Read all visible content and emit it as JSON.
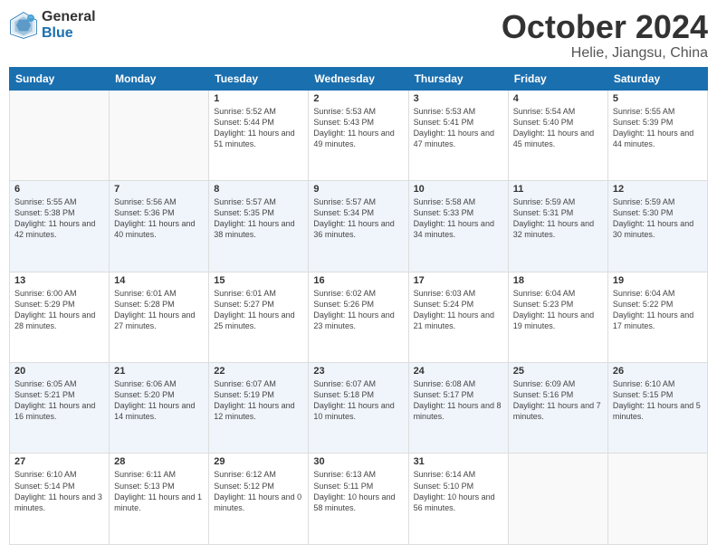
{
  "logo": {
    "general": "General",
    "blue": "Blue"
  },
  "header": {
    "title": "October 2024",
    "subtitle": "Helie, Jiangsu, China"
  },
  "weekdays": [
    "Sunday",
    "Monday",
    "Tuesday",
    "Wednesday",
    "Thursday",
    "Friday",
    "Saturday"
  ],
  "weeks": [
    [
      {
        "day": "",
        "content": ""
      },
      {
        "day": "",
        "content": ""
      },
      {
        "day": "1",
        "content": "Sunrise: 5:52 AM\nSunset: 5:44 PM\nDaylight: 11 hours and 51 minutes."
      },
      {
        "day": "2",
        "content": "Sunrise: 5:53 AM\nSunset: 5:43 PM\nDaylight: 11 hours and 49 minutes."
      },
      {
        "day": "3",
        "content": "Sunrise: 5:53 AM\nSunset: 5:41 PM\nDaylight: 11 hours and 47 minutes."
      },
      {
        "day": "4",
        "content": "Sunrise: 5:54 AM\nSunset: 5:40 PM\nDaylight: 11 hours and 45 minutes."
      },
      {
        "day": "5",
        "content": "Sunrise: 5:55 AM\nSunset: 5:39 PM\nDaylight: 11 hours and 44 minutes."
      }
    ],
    [
      {
        "day": "6",
        "content": "Sunrise: 5:55 AM\nSunset: 5:38 PM\nDaylight: 11 hours and 42 minutes."
      },
      {
        "day": "7",
        "content": "Sunrise: 5:56 AM\nSunset: 5:36 PM\nDaylight: 11 hours and 40 minutes."
      },
      {
        "day": "8",
        "content": "Sunrise: 5:57 AM\nSunset: 5:35 PM\nDaylight: 11 hours and 38 minutes."
      },
      {
        "day": "9",
        "content": "Sunrise: 5:57 AM\nSunset: 5:34 PM\nDaylight: 11 hours and 36 minutes."
      },
      {
        "day": "10",
        "content": "Sunrise: 5:58 AM\nSunset: 5:33 PM\nDaylight: 11 hours and 34 minutes."
      },
      {
        "day": "11",
        "content": "Sunrise: 5:59 AM\nSunset: 5:31 PM\nDaylight: 11 hours and 32 minutes."
      },
      {
        "day": "12",
        "content": "Sunrise: 5:59 AM\nSunset: 5:30 PM\nDaylight: 11 hours and 30 minutes."
      }
    ],
    [
      {
        "day": "13",
        "content": "Sunrise: 6:00 AM\nSunset: 5:29 PM\nDaylight: 11 hours and 28 minutes."
      },
      {
        "day": "14",
        "content": "Sunrise: 6:01 AM\nSunset: 5:28 PM\nDaylight: 11 hours and 27 minutes."
      },
      {
        "day": "15",
        "content": "Sunrise: 6:01 AM\nSunset: 5:27 PM\nDaylight: 11 hours and 25 minutes."
      },
      {
        "day": "16",
        "content": "Sunrise: 6:02 AM\nSunset: 5:26 PM\nDaylight: 11 hours and 23 minutes."
      },
      {
        "day": "17",
        "content": "Sunrise: 6:03 AM\nSunset: 5:24 PM\nDaylight: 11 hours and 21 minutes."
      },
      {
        "day": "18",
        "content": "Sunrise: 6:04 AM\nSunset: 5:23 PM\nDaylight: 11 hours and 19 minutes."
      },
      {
        "day": "19",
        "content": "Sunrise: 6:04 AM\nSunset: 5:22 PM\nDaylight: 11 hours and 17 minutes."
      }
    ],
    [
      {
        "day": "20",
        "content": "Sunrise: 6:05 AM\nSunset: 5:21 PM\nDaylight: 11 hours and 16 minutes."
      },
      {
        "day": "21",
        "content": "Sunrise: 6:06 AM\nSunset: 5:20 PM\nDaylight: 11 hours and 14 minutes."
      },
      {
        "day": "22",
        "content": "Sunrise: 6:07 AM\nSunset: 5:19 PM\nDaylight: 11 hours and 12 minutes."
      },
      {
        "day": "23",
        "content": "Sunrise: 6:07 AM\nSunset: 5:18 PM\nDaylight: 11 hours and 10 minutes."
      },
      {
        "day": "24",
        "content": "Sunrise: 6:08 AM\nSunset: 5:17 PM\nDaylight: 11 hours and 8 minutes."
      },
      {
        "day": "25",
        "content": "Sunrise: 6:09 AM\nSunset: 5:16 PM\nDaylight: 11 hours and 7 minutes."
      },
      {
        "day": "26",
        "content": "Sunrise: 6:10 AM\nSunset: 5:15 PM\nDaylight: 11 hours and 5 minutes."
      }
    ],
    [
      {
        "day": "27",
        "content": "Sunrise: 6:10 AM\nSunset: 5:14 PM\nDaylight: 11 hours and 3 minutes."
      },
      {
        "day": "28",
        "content": "Sunrise: 6:11 AM\nSunset: 5:13 PM\nDaylight: 11 hours and 1 minute."
      },
      {
        "day": "29",
        "content": "Sunrise: 6:12 AM\nSunset: 5:12 PM\nDaylight: 11 hours and 0 minutes."
      },
      {
        "day": "30",
        "content": "Sunrise: 6:13 AM\nSunset: 5:11 PM\nDaylight: 10 hours and 58 minutes."
      },
      {
        "day": "31",
        "content": "Sunrise: 6:14 AM\nSunset: 5:10 PM\nDaylight: 10 hours and 56 minutes."
      },
      {
        "day": "",
        "content": ""
      },
      {
        "day": "",
        "content": ""
      }
    ]
  ]
}
